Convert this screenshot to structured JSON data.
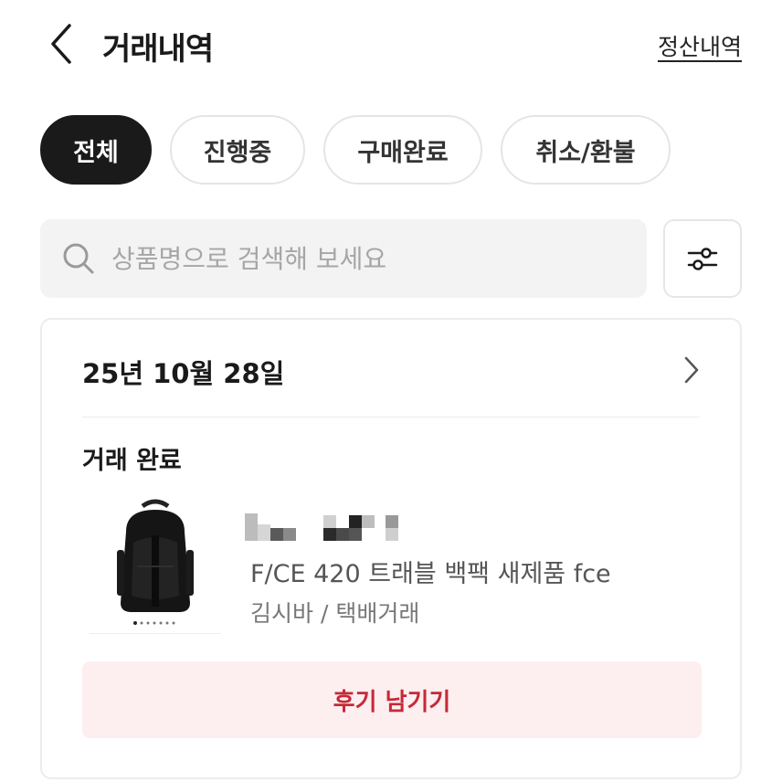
{
  "header": {
    "title": "거래내역",
    "settlement_link": "정산내역"
  },
  "tabs": [
    {
      "label": "전체",
      "active": true
    },
    {
      "label": "진행중",
      "active": false
    },
    {
      "label": "구매완료",
      "active": false
    },
    {
      "label": "취소/환불",
      "active": false
    }
  ],
  "search": {
    "placeholder": "상품명으로 검색해 보세요",
    "value": ""
  },
  "order": {
    "date": "25년 10월 28일",
    "status": "거래 완료",
    "product_name": "F/CE 420 트래블 백팩 새제품 fce",
    "seller_and_method": "김시바 / 택배거래",
    "review_button": "후기 남기기"
  },
  "colors": {
    "accent_text": "#c52a37",
    "review_button_bg": "#fdeef0",
    "active_tab_bg": "#1a1a1a"
  },
  "icons": [
    "chevron-left-icon",
    "search-icon",
    "filter-sliders-icon",
    "chevron-right-icon"
  ]
}
